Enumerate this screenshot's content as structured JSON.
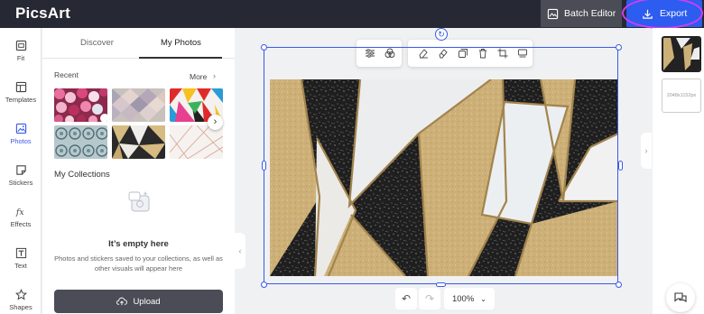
{
  "app": {
    "logo": "PicsArt"
  },
  "header": {
    "batch_label": "Batch Editor",
    "export_label": "Export"
  },
  "nav": {
    "items": [
      {
        "label": "Fit",
        "icon": "fit-icon"
      },
      {
        "label": "Templates",
        "icon": "templates-icon"
      },
      {
        "label": "Photos",
        "icon": "photos-icon",
        "active": true
      },
      {
        "label": "Stickers",
        "icon": "stickers-icon"
      },
      {
        "label": "Effects",
        "icon": "effects-icon"
      },
      {
        "label": "Text",
        "icon": "text-icon"
      },
      {
        "label": "Shapes",
        "icon": "shapes-icon"
      }
    ]
  },
  "panel": {
    "tabs": [
      "Discover",
      "My Photos"
    ],
    "active_tab": "My Photos",
    "recent_label": "Recent",
    "more_label": "More",
    "collections_title": "My Collections",
    "empty_title": "It’s empty here",
    "empty_desc": "Photos and stickers saved to your collections, as well as other visuals will appear here",
    "upload_label": "Upload"
  },
  "zoom": {
    "value": "100%"
  },
  "right": {
    "size_label": "2048x1152px"
  },
  "colors": {
    "accent": "#2d5cf0",
    "topbar": "#262833",
    "highlight": "#d33cf0",
    "gold": "#cdb078",
    "marble": "#ecedee",
    "granite": "#222222"
  }
}
